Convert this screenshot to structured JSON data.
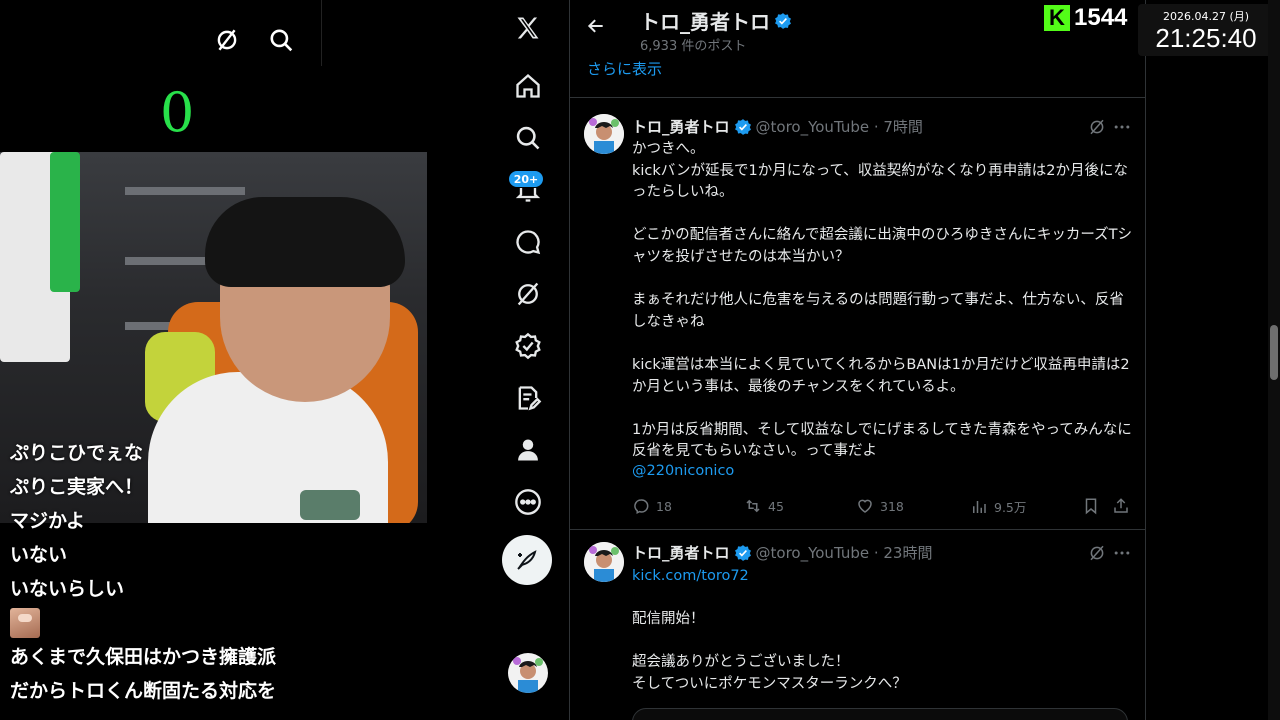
{
  "stream": {
    "counter": "0",
    "chat": [
      "ぷりこひでぇな",
      "ぷりこ実家へ！",
      "マジかよ",
      "いない",
      "いないらしい",
      "あくまで久保田はかつき擁護派",
      "だからトロくん断固たる対応を"
    ]
  },
  "kick": {
    "logo": "K",
    "viewers": "1544"
  },
  "clock": {
    "date": "2026.04.27 (月)",
    "time": "21:25:40"
  },
  "nav": {
    "notifications_badge": "20+"
  },
  "profile": {
    "name": "トロ_勇者トロ",
    "post_count": "6,933 件のポスト",
    "show_more": "さらに表示"
  },
  "tweets": [
    {
      "name": "トロ_勇者トロ",
      "handle": "@toro_YouTube · 7時間",
      "body": "かつきへ。\nkickバンが延長で1か月になって、収益契約がなくなり再申請は2か月後になったらしいね。\n\nどこかの配信者さんに絡んで超会議に出演中のひろゆきさんにキッカーズTシャツを投げさせたのは本当かい？\n\nまぁそれだけ他人に危害を与えるのは問題行動って事だよ、仕方ない、反省しなきゃね\n\nkick運営は本当によく見ていてくれるからBANは1か月だけど収益再申請は2か月という事は、最後のチャンスをくれているよ。\n\n1か月は反省期間、そして収益なしでにげまるしてきた青森をやってみんなに反省を見てもらいなさい。って事だよ",
      "mention": "@220niconico",
      "replies": "18",
      "reposts": "45",
      "likes": "318",
      "views": "9.5万"
    },
    {
      "name": "トロ_勇者トロ",
      "handle": "@toro_YouTube · 23時間",
      "link": "kick.com/toro72",
      "body": "配信開始！\n\n超会議ありがとうございました！\nそしてついにポケモンマスターランクへ？"
    }
  ],
  "colors": {
    "accent": "#1d9bf0",
    "kick_green": "#53fc18",
    "counter_green": "#28e04a"
  }
}
